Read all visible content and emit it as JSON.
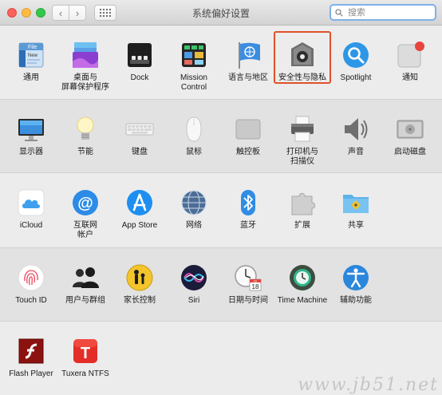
{
  "window": {
    "title": "系统偏好设置"
  },
  "search": {
    "placeholder": "搜索"
  },
  "sections": [
    [
      {
        "label": "通用",
        "icon": "general-icon"
      },
      {
        "label": "桌面与\n屏幕保护程序",
        "icon": "desktop-screensaver-icon"
      },
      {
        "label": "Dock",
        "icon": "dock-icon"
      },
      {
        "label": "Mission\nControl",
        "icon": "mission-control-icon"
      },
      {
        "label": "语言与地区",
        "icon": "language-region-icon"
      },
      {
        "label": "安全性与隐私",
        "icon": "security-privacy-icon"
      },
      {
        "label": "Spotlight",
        "icon": "spotlight-icon"
      },
      {
        "label": "通知",
        "icon": "notifications-icon"
      }
    ],
    [
      {
        "label": "显示器",
        "icon": "displays-icon"
      },
      {
        "label": "节能",
        "icon": "energy-saver-icon"
      },
      {
        "label": "键盘",
        "icon": "keyboard-icon"
      },
      {
        "label": "鼠标",
        "icon": "mouse-icon"
      },
      {
        "label": "触控板",
        "icon": "trackpad-icon"
      },
      {
        "label": "打印机与\n扫描仪",
        "icon": "printers-scanners-icon"
      },
      {
        "label": "声音",
        "icon": "sound-icon"
      },
      {
        "label": "启动磁盘",
        "icon": "startup-disk-icon"
      }
    ],
    [
      {
        "label": "iCloud",
        "icon": "icloud-icon"
      },
      {
        "label": "互联网\n帐户",
        "icon": "internet-accounts-icon"
      },
      {
        "label": "App Store",
        "icon": "app-store-icon"
      },
      {
        "label": "网络",
        "icon": "network-icon"
      },
      {
        "label": "蓝牙",
        "icon": "bluetooth-icon"
      },
      {
        "label": "扩展",
        "icon": "extensions-icon"
      },
      {
        "label": "共享",
        "icon": "sharing-icon"
      }
    ],
    [
      {
        "label": "Touch ID",
        "icon": "touch-id-icon"
      },
      {
        "label": "用户与群组",
        "icon": "users-groups-icon"
      },
      {
        "label": "家长控制",
        "icon": "parental-controls-icon"
      },
      {
        "label": "Siri",
        "icon": "siri-icon"
      },
      {
        "label": "日期与时间",
        "icon": "date-time-icon"
      },
      {
        "label": "Time Machine",
        "icon": "time-machine-icon"
      },
      {
        "label": "辅助功能",
        "icon": "accessibility-icon"
      }
    ],
    [
      {
        "label": "Flash Player",
        "icon": "flash-player-icon"
      },
      {
        "label": "Tuxera NTFS",
        "icon": "tuxera-ntfs-icon"
      }
    ]
  ],
  "icons": {
    "general": {
      "text": "File\nNew"
    },
    "date": {
      "month": "JUL",
      "day": "18"
    },
    "tuxera": {
      "letter": "T"
    }
  },
  "colors": {
    "highlight": "#e0502a",
    "search_border": "#7fb0e8"
  },
  "watermark": "www.jb51.net"
}
